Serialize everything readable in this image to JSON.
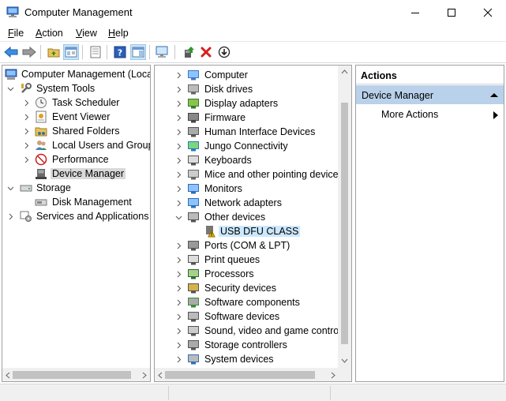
{
  "window": {
    "title": "Computer Management"
  },
  "menu": [
    {
      "accel": "F",
      "rest": "ile"
    },
    {
      "accel": "A",
      "rest": "ction"
    },
    {
      "accel": "V",
      "rest": "iew"
    },
    {
      "accel": "H",
      "rest": "elp"
    }
  ],
  "left_tree": {
    "root": "Computer Management (Local",
    "system_tools": "System Tools",
    "task_scheduler": "Task Scheduler",
    "event_viewer": "Event Viewer",
    "shared_folders": "Shared Folders",
    "local_users": "Local Users and Groups",
    "performance": "Performance",
    "device_manager": "Device Manager",
    "storage": "Storage",
    "disk_management": "Disk Management",
    "services": "Services and Applications"
  },
  "devices": [
    {
      "label": "Computer",
      "icon": "computer-icon"
    },
    {
      "label": "Disk drives",
      "icon": "disk-drive-icon"
    },
    {
      "label": "Display adapters",
      "icon": "display-adapter-icon"
    },
    {
      "label": "Firmware",
      "icon": "firmware-icon"
    },
    {
      "label": "Human Interface Devices",
      "icon": "hid-icon"
    },
    {
      "label": "Jungo Connectivity",
      "icon": "jungo-icon"
    },
    {
      "label": "Keyboards",
      "icon": "keyboard-icon"
    },
    {
      "label": "Mice and other pointing devices",
      "icon": "mouse-icon"
    },
    {
      "label": "Monitors",
      "icon": "monitor-icon"
    },
    {
      "label": "Network adapters",
      "icon": "network-adapter-icon"
    },
    {
      "label": "Other devices",
      "icon": "other-devices-icon"
    },
    {
      "label": "USB DFU CLASS",
      "icon": "warning-device-icon"
    },
    {
      "label": "Ports (COM & LPT)",
      "icon": "port-icon"
    },
    {
      "label": "Print queues",
      "icon": "printer-icon"
    },
    {
      "label": "Processors",
      "icon": "processor-icon"
    },
    {
      "label": "Security devices",
      "icon": "security-device-icon"
    },
    {
      "label": "Software components",
      "icon": "software-component-icon"
    },
    {
      "label": "Software devices",
      "icon": "software-device-icon"
    },
    {
      "label": "Sound, video and game controll",
      "icon": "sound-icon"
    },
    {
      "label": "Storage controllers",
      "icon": "storage-controller-icon"
    },
    {
      "label": "System devices",
      "icon": "system-device-icon"
    }
  ],
  "actions": {
    "header": "Actions",
    "group": "Device Manager",
    "more": "More Actions"
  }
}
